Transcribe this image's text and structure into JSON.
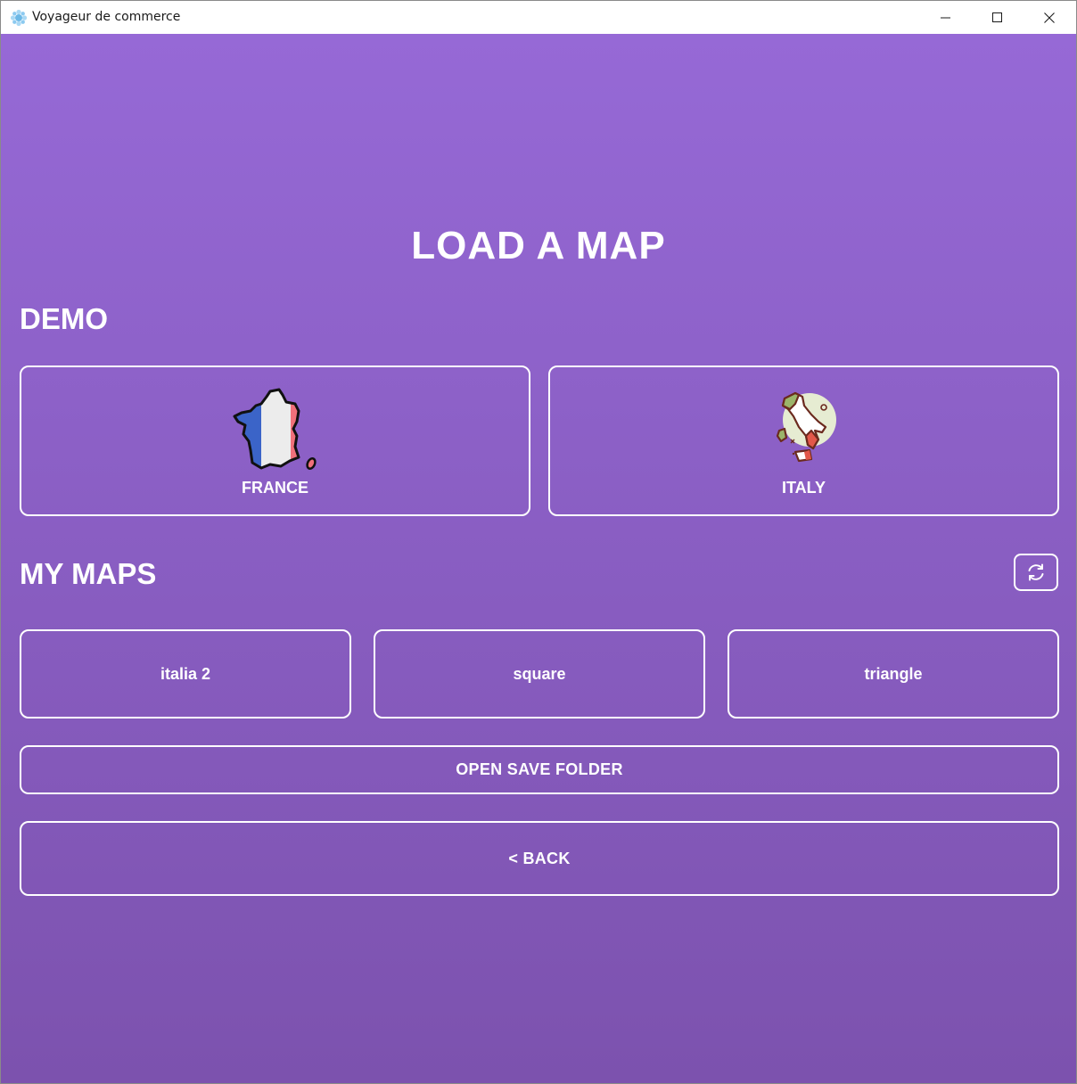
{
  "window": {
    "title": "Voyageur de commerce",
    "controls": [
      "minimize-icon",
      "maximize-icon",
      "close-icon"
    ]
  },
  "page": {
    "title": "LOAD A MAP"
  },
  "demo": {
    "heading": "DEMO",
    "cards": [
      {
        "label": "FRANCE",
        "icon": "france-map-icon"
      },
      {
        "label": "ITALY",
        "icon": "italy-map-icon"
      }
    ]
  },
  "my_maps": {
    "heading": "MY MAPS",
    "refresh_icon": "refresh-icon",
    "items": [
      {
        "label": "italia 2"
      },
      {
        "label": "square"
      },
      {
        "label": "triangle"
      }
    ]
  },
  "actions": {
    "open_save_folder": "OPEN SAVE FOLDER",
    "back": "< BACK"
  },
  "colors": {
    "gradient_top": "#9669d6",
    "gradient_bottom": "#7c52ae",
    "text": "#ffffff",
    "border": "#ffffff"
  }
}
